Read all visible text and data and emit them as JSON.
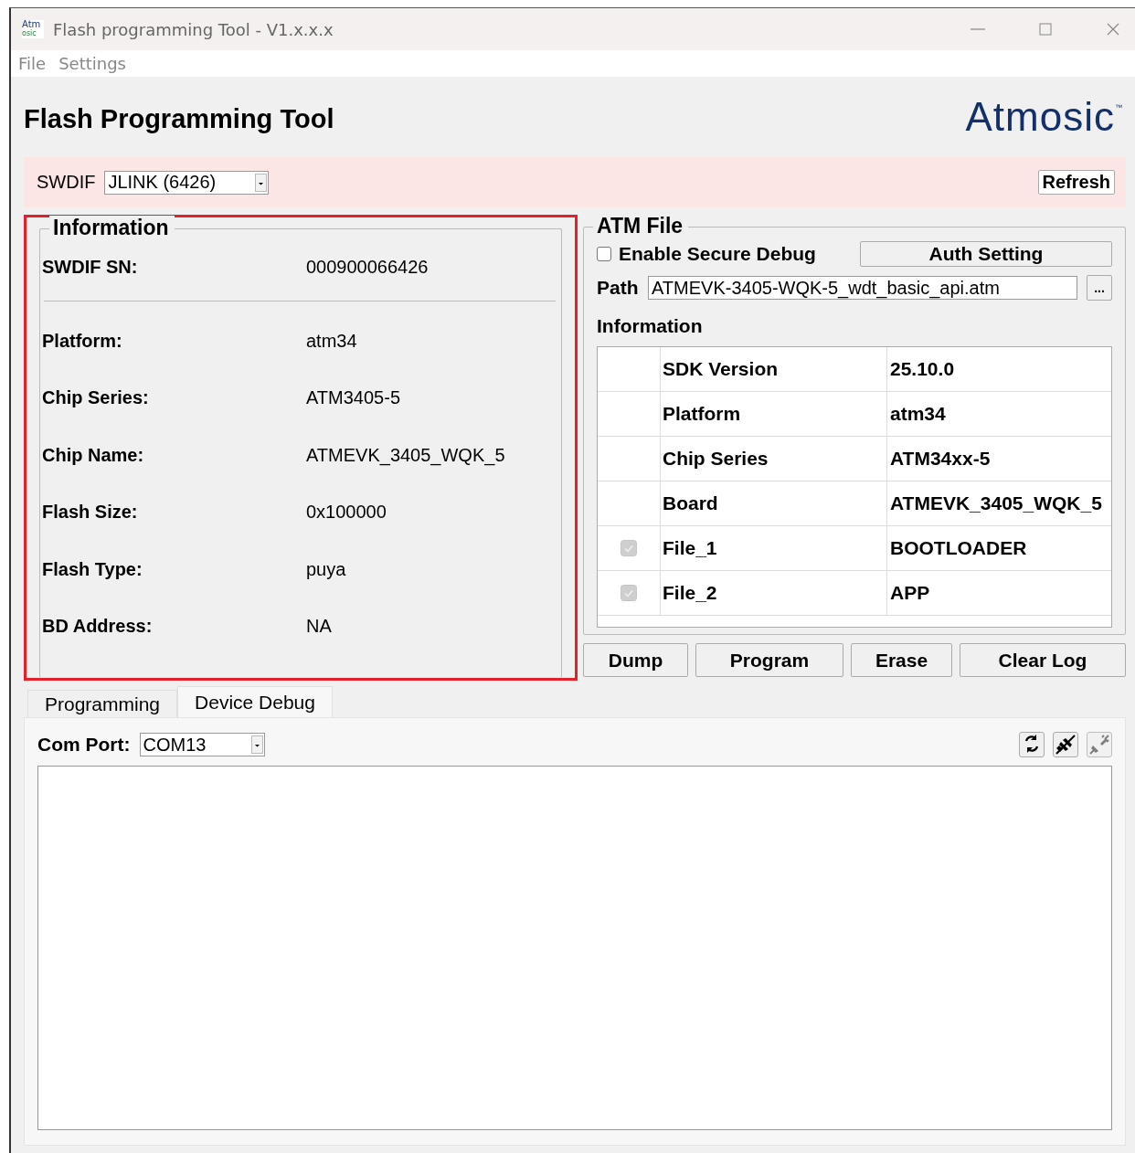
{
  "window": {
    "app_icon": [
      "Atm",
      "osic"
    ],
    "title": "Flash programming Tool - V1.x.x.x"
  },
  "menu": [
    "File",
    "Settings"
  ],
  "header": {
    "title": "Flash Programming Tool",
    "logo": "Atmosic",
    "logo_mark": "™"
  },
  "swdif": {
    "label": "SWDIF",
    "value": "JLINK (6426)",
    "refresh": "Refresh"
  },
  "info": {
    "title": "Information",
    "serial": {
      "label": "SWDIF SN:",
      "value": "000900066426"
    },
    "fields": [
      {
        "label": "Platform:",
        "value": "atm34"
      },
      {
        "label": "Chip Series:",
        "value": "ATM3405-5"
      },
      {
        "label": "Chip Name:",
        "value": "ATMEVK_3405_WQK_5"
      },
      {
        "label": "Flash Size:",
        "value": "0x100000"
      },
      {
        "label": "Flash Type:",
        "value": "puya"
      },
      {
        "label": "BD Address:",
        "value": "NA"
      }
    ]
  },
  "atm_file": {
    "title": "ATM File",
    "secure_debug": {
      "label": "Enable Secure Debug",
      "checked": false
    },
    "auth_button": "Auth Setting",
    "path": {
      "label": "Path",
      "value": "ATMEVK-3405-WQK-5_wdt_basic_api.atm",
      "browse": "..."
    },
    "info_label": "Information",
    "rows": [
      {
        "kind": "plain",
        "name": "SDK Version",
        "value": "25.10.0"
      },
      {
        "kind": "plain",
        "name": "Platform",
        "value": "atm34"
      },
      {
        "kind": "plain",
        "name": "Chip Series",
        "value": "ATM34xx-5"
      },
      {
        "kind": "plain",
        "name": "Board",
        "value": "ATMEVK_3405_WQK_5"
      },
      {
        "kind": "check",
        "name": "File_1",
        "value": "BOOTLOADER",
        "checked": true
      },
      {
        "kind": "check",
        "name": "File_2",
        "value": "APP",
        "checked": true
      }
    ]
  },
  "actions": [
    "Dump",
    "Program",
    "Erase",
    "Clear Log"
  ],
  "tabs": [
    {
      "label": "Programming",
      "selected": false
    },
    {
      "label": "Device Debug",
      "selected": true
    }
  ],
  "debug": {
    "com_label": "Com Port:",
    "com_value": "COM13",
    "tools": [
      {
        "kind": "refresh",
        "disabled": false
      },
      {
        "kind": "connect",
        "disabled": false
      },
      {
        "kind": "disconnect",
        "disabled": true
      }
    ]
  }
}
